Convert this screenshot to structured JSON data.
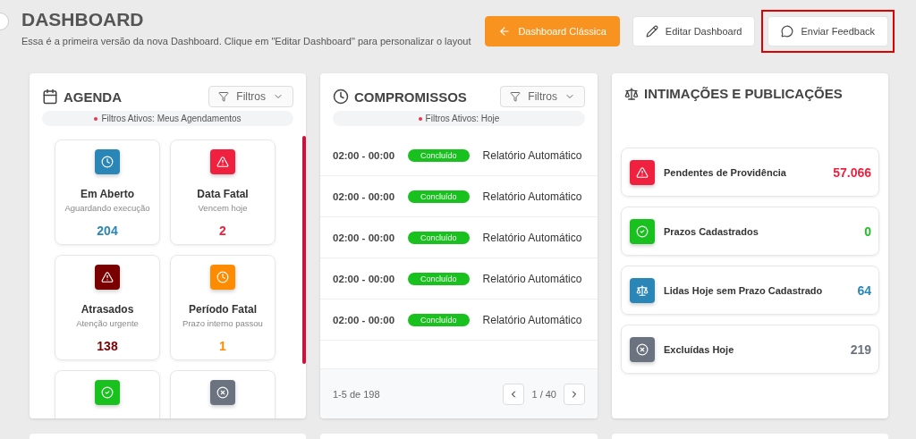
{
  "header": {
    "title": "DASHBOARD",
    "subtitle": "Essa é a primeira versão da nova Dashboard. Clique em \"Editar Dashboard\" para personalizar o layout",
    "buttons": [
      {
        "kind": "back",
        "label": "Dashboard Clássica",
        "highlighted": false
      },
      {
        "kind": "edit",
        "label": "Editar Dashboard",
        "highlighted": false
      },
      {
        "kind": "feedback",
        "label": "Enviar Feedback",
        "highlighted": true
      }
    ]
  },
  "agenda": {
    "title": "AGENDA",
    "filter_button": "Filtros",
    "active_filters": "Filtros Ativos: Meus Agendamentos",
    "tiles": [
      {
        "kind": "clock",
        "color": "#2b86b8",
        "title": "Em Aberto",
        "subtitle": "Aguardando execução",
        "count": "204"
      },
      {
        "kind": "alert",
        "color": "#f0203f",
        "title": "Data Fatal",
        "subtitle": "Vencem hoje",
        "count": "2"
      },
      {
        "kind": "alert",
        "color": "#7a0000",
        "title": "Atrasados",
        "subtitle": "Atenção urgente",
        "count": "138"
      },
      {
        "kind": "clock",
        "color": "#ff8c00",
        "title": "Período Fatal",
        "subtitle": "Prazo interno passou",
        "count": "1"
      },
      {
        "kind": "check",
        "color": "#19c11e"
      },
      {
        "kind": "x",
        "color": "#6b7280"
      }
    ]
  },
  "compromissos": {
    "title": "COMPROMISSOS",
    "filter_button": "Filtros",
    "active_filters": "Filtros Ativos: Hoje",
    "rows": [
      {
        "time": "02:00 - 00:00",
        "status": "Concluído",
        "description": "Relatório Automático"
      },
      {
        "time": "02:00 - 00:00",
        "status": "Concluído",
        "description": "Relatório Automático"
      },
      {
        "time": "02:00 - 00:00",
        "status": "Concluído",
        "description": "Relatório Automático"
      },
      {
        "time": "02:00 - 00:00",
        "status": "Concluído",
        "description": "Relatório Automático"
      },
      {
        "time": "02:00 - 00:00",
        "status": "Concluído",
        "description": "Relatório Automático"
      }
    ],
    "pagination": {
      "summary": "1-5 de 198",
      "page": "1 / 40"
    }
  },
  "intimacoes": {
    "title": "INTIMAÇÕES E PUBLICAÇÕES",
    "items": [
      {
        "kind": "alert",
        "color": "#f0203f",
        "label": "Pendentes de Providência",
        "count": "57.066"
      },
      {
        "kind": "check",
        "color": "#19c11e",
        "label": "Prazos Cadastrados",
        "count": "0"
      },
      {
        "kind": "scale",
        "color": "#2b86b8",
        "label": "Lidas Hoje sem Prazo Cadastrado",
        "count": "64"
      },
      {
        "kind": "x",
        "color": "#6b7280",
        "label": "Excluídas Hoje",
        "count": "219"
      }
    ]
  }
}
